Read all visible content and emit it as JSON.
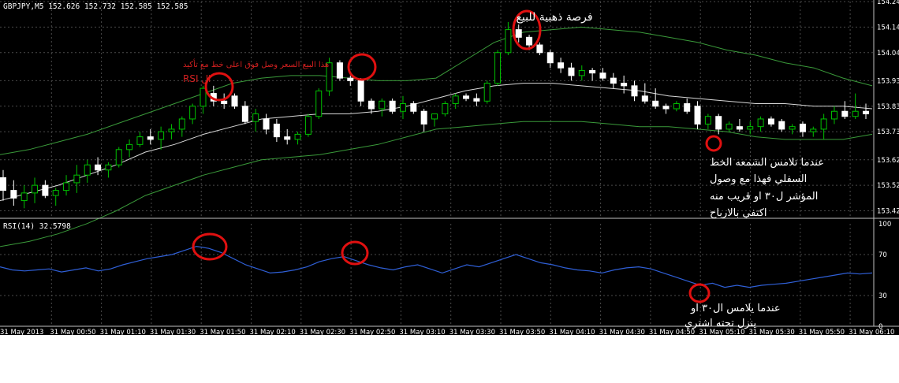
{
  "header": {
    "symbol_line": "GBPJPY,M5  152.626 152.732 152.585 152.585",
    "rsi_line": "RSI(14) 32.5798"
  },
  "colors": {
    "background": "#000000",
    "grid": "#4a4a4a",
    "bull_candle": "#00c000",
    "bear_candle": "#ffffff",
    "band_outer": "#3a9a3a",
    "band_middle": "#d8d8d8",
    "rsi_line": "#2f5fd6",
    "annotation_circle": "#e01010",
    "annotation_text": "#ffffff",
    "annotation_red_text": "#d22020",
    "axis_text": "#ffffff"
  },
  "chart_data": [
    {
      "type": "candlestick",
      "name": "price",
      "ylim": [
        153.4,
        154.24
      ],
      "y_ticks": [
        "154.24",
        "154.14",
        "154.04",
        "153.93",
        "153.83",
        "153.73",
        "153.62",
        "153.52",
        "153.42"
      ],
      "candles": [
        {
          "o": 153.55,
          "h": 153.58,
          "l": 153.46,
          "c": 153.5
        },
        {
          "o": 153.5,
          "h": 153.54,
          "l": 153.44,
          "c": 153.47
        },
        {
          "o": 153.46,
          "h": 153.52,
          "l": 153.43,
          "c": 153.49
        },
        {
          "o": 153.49,
          "h": 153.55,
          "l": 153.45,
          "c": 153.52
        },
        {
          "o": 153.52,
          "h": 153.54,
          "l": 153.47,
          "c": 153.48
        },
        {
          "o": 153.48,
          "h": 153.51,
          "l": 153.44,
          "c": 153.5
        },
        {
          "o": 153.5,
          "h": 153.56,
          "l": 153.48,
          "c": 153.53
        },
        {
          "o": 153.53,
          "h": 153.6,
          "l": 153.49,
          "c": 153.56
        },
        {
          "o": 153.56,
          "h": 153.62,
          "l": 153.53,
          "c": 153.6
        },
        {
          "o": 153.6,
          "h": 153.63,
          "l": 153.56,
          "c": 153.58
        },
        {
          "o": 153.58,
          "h": 153.61,
          "l": 153.55,
          "c": 153.6
        },
        {
          "o": 153.6,
          "h": 153.67,
          "l": 153.59,
          "c": 153.66
        },
        {
          "o": 153.66,
          "h": 153.7,
          "l": 153.63,
          "c": 153.68
        },
        {
          "o": 153.68,
          "h": 153.73,
          "l": 153.67,
          "c": 153.71
        },
        {
          "o": 153.71,
          "h": 153.74,
          "l": 153.68,
          "c": 153.7
        },
        {
          "o": 153.7,
          "h": 153.75,
          "l": 153.66,
          "c": 153.73
        },
        {
          "o": 153.73,
          "h": 153.76,
          "l": 153.7,
          "c": 153.74
        },
        {
          "o": 153.74,
          "h": 153.79,
          "l": 153.71,
          "c": 153.78
        },
        {
          "o": 153.78,
          "h": 153.84,
          "l": 153.76,
          "c": 153.83
        },
        {
          "o": 153.83,
          "h": 153.91,
          "l": 153.8,
          "c": 153.9
        },
        {
          "o": 153.88,
          "h": 153.91,
          "l": 153.83,
          "c": 153.85
        },
        {
          "o": 153.85,
          "h": 153.88,
          "l": 153.82,
          "c": 153.84
        },
        {
          "o": 153.87,
          "h": 153.88,
          "l": 153.82,
          "c": 153.83
        },
        {
          "o": 153.83,
          "h": 153.85,
          "l": 153.76,
          "c": 153.77
        },
        {
          "o": 153.77,
          "h": 153.82,
          "l": 153.73,
          "c": 153.8
        },
        {
          "o": 153.78,
          "h": 153.8,
          "l": 153.72,
          "c": 153.74
        },
        {
          "o": 153.76,
          "h": 153.78,
          "l": 153.69,
          "c": 153.71
        },
        {
          "o": 153.71,
          "h": 153.74,
          "l": 153.68,
          "c": 153.7
        },
        {
          "o": 153.7,
          "h": 153.73,
          "l": 153.68,
          "c": 153.72
        },
        {
          "o": 153.72,
          "h": 153.8,
          "l": 153.71,
          "c": 153.79
        },
        {
          "o": 153.79,
          "h": 153.9,
          "l": 153.78,
          "c": 153.89
        },
        {
          "o": 153.89,
          "h": 154.02,
          "l": 153.87,
          "c": 154.0
        },
        {
          "o": 154.0,
          "h": 154.01,
          "l": 153.93,
          "c": 153.94
        },
        {
          "o": 153.94,
          "h": 153.95,
          "l": 153.91,
          "c": 153.93
        },
        {
          "o": 153.93,
          "h": 153.94,
          "l": 153.83,
          "c": 153.85
        },
        {
          "o": 153.85,
          "h": 153.86,
          "l": 153.8,
          "c": 153.82
        },
        {
          "o": 153.82,
          "h": 153.86,
          "l": 153.79,
          "c": 153.85
        },
        {
          "o": 153.85,
          "h": 153.86,
          "l": 153.8,
          "c": 153.81
        },
        {
          "o": 153.81,
          "h": 153.87,
          "l": 153.78,
          "c": 153.84
        },
        {
          "o": 153.84,
          "h": 153.85,
          "l": 153.8,
          "c": 153.81
        },
        {
          "o": 153.81,
          "h": 153.82,
          "l": 153.73,
          "c": 153.76
        },
        {
          "o": 153.78,
          "h": 153.8,
          "l": 153.75,
          "c": 153.8
        },
        {
          "o": 153.8,
          "h": 153.85,
          "l": 153.79,
          "c": 153.84
        },
        {
          "o": 153.84,
          "h": 153.88,
          "l": 153.82,
          "c": 153.87
        },
        {
          "o": 153.87,
          "h": 153.88,
          "l": 153.85,
          "c": 153.86
        },
        {
          "o": 153.86,
          "h": 153.88,
          "l": 153.83,
          "c": 153.85
        },
        {
          "o": 153.85,
          "h": 153.93,
          "l": 153.84,
          "c": 153.92
        },
        {
          "o": 153.92,
          "h": 154.05,
          "l": 153.91,
          "c": 154.04
        },
        {
          "o": 154.04,
          "h": 154.16,
          "l": 154.03,
          "c": 154.13
        },
        {
          "o": 154.13,
          "h": 154.15,
          "l": 154.08,
          "c": 154.1
        },
        {
          "o": 154.1,
          "h": 154.11,
          "l": 154.05,
          "c": 154.07
        },
        {
          "o": 154.07,
          "h": 154.08,
          "l": 154.03,
          "c": 154.04
        },
        {
          "o": 154.04,
          "h": 154.05,
          "l": 153.98,
          "c": 154.0
        },
        {
          "o": 154.0,
          "h": 154.02,
          "l": 153.96,
          "c": 153.98
        },
        {
          "o": 153.98,
          "h": 154.0,
          "l": 153.93,
          "c": 153.95
        },
        {
          "o": 153.95,
          "h": 153.99,
          "l": 153.93,
          "c": 153.97
        },
        {
          "o": 153.97,
          "h": 153.98,
          "l": 153.93,
          "c": 153.96
        },
        {
          "o": 153.96,
          "h": 153.98,
          "l": 153.93,
          "c": 153.94
        },
        {
          "o": 153.94,
          "h": 153.96,
          "l": 153.9,
          "c": 153.92
        },
        {
          "o": 153.92,
          "h": 153.95,
          "l": 153.88,
          "c": 153.91
        },
        {
          "o": 153.91,
          "h": 153.93,
          "l": 153.85,
          "c": 153.87
        },
        {
          "o": 153.87,
          "h": 153.92,
          "l": 153.84,
          "c": 153.85
        },
        {
          "o": 153.85,
          "h": 153.9,
          "l": 153.82,
          "c": 153.83
        },
        {
          "o": 153.83,
          "h": 153.84,
          "l": 153.8,
          "c": 153.82
        },
        {
          "o": 153.82,
          "h": 153.85,
          "l": 153.81,
          "c": 153.84
        },
        {
          "o": 153.84,
          "h": 153.86,
          "l": 153.8,
          "c": 153.81
        },
        {
          "o": 153.83,
          "h": 153.85,
          "l": 153.74,
          "c": 153.76
        },
        {
          "o": 153.76,
          "h": 153.8,
          "l": 153.74,
          "c": 153.79
        },
        {
          "o": 153.79,
          "h": 153.8,
          "l": 153.72,
          "c": 153.74
        },
        {
          "o": 153.74,
          "h": 153.77,
          "l": 153.73,
          "c": 153.76
        },
        {
          "o": 153.75,
          "h": 153.78,
          "l": 153.73,
          "c": 153.74
        },
        {
          "o": 153.74,
          "h": 153.77,
          "l": 153.72,
          "c": 153.75
        },
        {
          "o": 153.75,
          "h": 153.79,
          "l": 153.73,
          "c": 153.78
        },
        {
          "o": 153.78,
          "h": 153.79,
          "l": 153.75,
          "c": 153.76
        },
        {
          "o": 153.77,
          "h": 153.78,
          "l": 153.73,
          "c": 153.74
        },
        {
          "o": 153.74,
          "h": 153.76,
          "l": 153.72,
          "c": 153.75
        },
        {
          "o": 153.76,
          "h": 153.77,
          "l": 153.71,
          "c": 153.73
        },
        {
          "o": 153.73,
          "h": 153.75,
          "l": 153.71,
          "c": 153.74
        },
        {
          "o": 153.74,
          "h": 153.8,
          "l": 153.7,
          "c": 153.78
        },
        {
          "o": 153.78,
          "h": 153.83,
          "l": 153.76,
          "c": 153.81
        },
        {
          "o": 153.81,
          "h": 153.85,
          "l": 153.78,
          "c": 153.79
        },
        {
          "o": 153.79,
          "h": 153.88,
          "l": 153.78,
          "c": 153.81
        },
        {
          "o": 153.81,
          "h": 153.84,
          "l": 153.78,
          "c": 153.8
        }
      ],
      "bands": {
        "upper": [
          153.64,
          153.66,
          153.69,
          153.72,
          153.76,
          153.8,
          153.84,
          153.88,
          153.92,
          153.94,
          153.95,
          153.95,
          153.94,
          153.93,
          153.93,
          153.94,
          154.01,
          154.08,
          154.12,
          154.13,
          154.14,
          154.13,
          154.12,
          154.1,
          154.08,
          154.05,
          154.03,
          154.0,
          153.98,
          153.94,
          153.91
        ],
        "middle": [
          153.46,
          153.49,
          153.52,
          153.56,
          153.6,
          153.65,
          153.68,
          153.72,
          153.75,
          153.78,
          153.79,
          153.8,
          153.8,
          153.81,
          153.83,
          153.86,
          153.89,
          153.91,
          153.92,
          153.92,
          153.91,
          153.9,
          153.89,
          153.87,
          153.86,
          153.85,
          153.84,
          153.84,
          153.83,
          153.83,
          153.82
        ],
        "lower": [
          153.28,
          153.3,
          153.33,
          153.37,
          153.42,
          153.48,
          153.52,
          153.56,
          153.59,
          153.62,
          153.63,
          153.64,
          153.66,
          153.68,
          153.71,
          153.74,
          153.75,
          153.76,
          153.77,
          153.77,
          153.77,
          153.76,
          153.75,
          153.75,
          153.74,
          153.73,
          153.71,
          153.7,
          153.7,
          153.7,
          153.72
        ]
      }
    },
    {
      "type": "line",
      "name": "RSI(14)",
      "ylim": [
        0,
        100
      ],
      "y_ticks": [
        "100",
        "70",
        "30",
        "0"
      ],
      "values": [
        58,
        55,
        54,
        55,
        56,
        53,
        55,
        57,
        54,
        56,
        60,
        63,
        66,
        68,
        70,
        74,
        78,
        76,
        72,
        66,
        60,
        56,
        52,
        53,
        55,
        58,
        63,
        66,
        68,
        64,
        60,
        57,
        55,
        58,
        60,
        56,
        52,
        56,
        60,
        58,
        62,
        66,
        70,
        66,
        62,
        60,
        57,
        55,
        54,
        52,
        55,
        57,
        58,
        56,
        52,
        48,
        44,
        40,
        42,
        38,
        40,
        38,
        40,
        41,
        42,
        44,
        46,
        48,
        50,
        52,
        51,
        52
      ]
    }
  ],
  "x_axis": {
    "labels": [
      "31 May 2013",
      "31 May 00:50",
      "31 May 01:10",
      "31 May 01:30",
      "31 May 01:50",
      "31 May 02:10",
      "31 May 02:30",
      "31 May 02:50",
      "31 May 03:10",
      "31 May 03:30",
      "31 May 03:50",
      "31 May 04:10",
      "31 May 04:30",
      "31 May 04:50",
      "31 May 05:10",
      "31 May 05:30",
      "31 May 05:50",
      "31 May 06:10"
    ]
  },
  "annotations": {
    "golden_sell": "فرصة ذهبية للبيع",
    "red_note_line1": "هذا البيع السعر وصل فوق اعلى خط مع تأكيد",
    "red_note_line2": "RSI ال",
    "lower_band_note": [
      "عندما تلامس الشمعه الخط",
      "السفلي فهذا مع وصول",
      "المؤشر ل٣٠ او قريب منه",
      "اكتفي بالارباح"
    ],
    "rsi_note": [
      "عندما يلامس ال٣٠ او",
      "ينزل تحته اشتري"
    ]
  }
}
